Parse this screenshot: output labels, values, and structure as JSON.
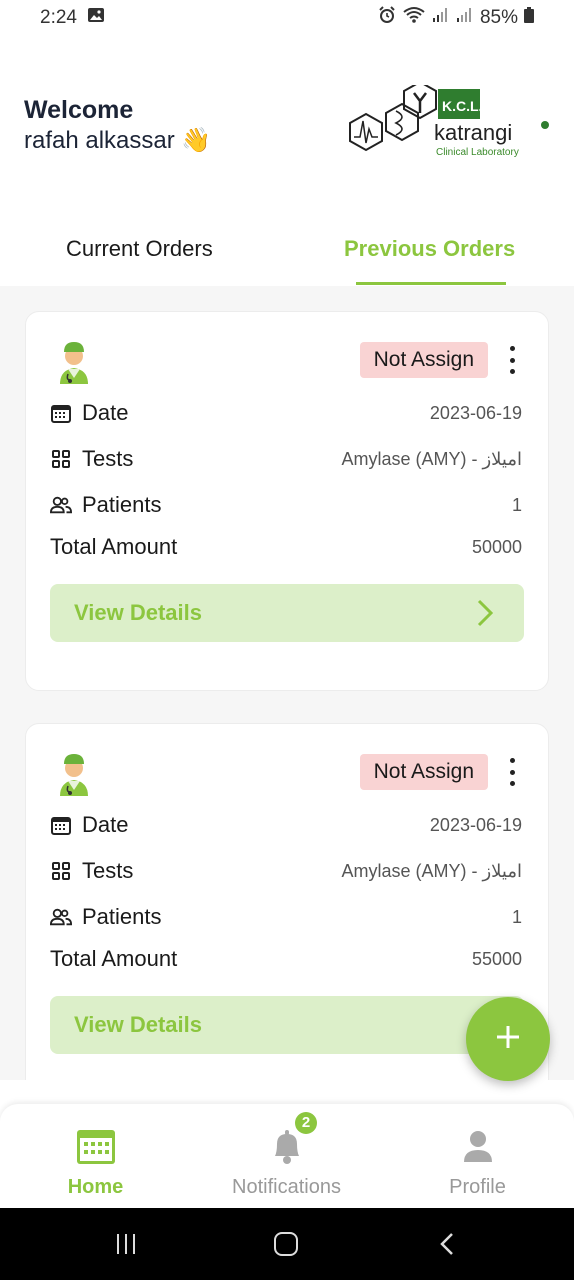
{
  "status_bar": {
    "time": "2:24",
    "battery": "85%"
  },
  "header": {
    "welcome": "Welcome",
    "username": "rafah alkassar 👋",
    "logo_title": "K.C.L.",
    "logo_name": "katrangi",
    "logo_subtitle": "Clinical Laboratory"
  },
  "tabs": {
    "current": "Current Orders",
    "previous": "Previous Orders"
  },
  "orders": [
    {
      "status": "Not Assign",
      "date_label": "Date",
      "date": "2023-06-19",
      "tests_label": "Tests",
      "tests": "Amylase (AMY) - اميلاز",
      "patients_label": "Patients",
      "patients": "1",
      "total_label": "Total Amount",
      "total": "50000",
      "view_details": "View Details"
    },
    {
      "status": "Not Assign",
      "date_label": "Date",
      "date": "2023-06-19",
      "tests_label": "Tests",
      "tests": "Amylase (AMY) - اميلاز",
      "patients_label": "Patients",
      "patients": "1",
      "total_label": "Total Amount",
      "total": "55000",
      "view_details": "View Details"
    }
  ],
  "bottom_nav": {
    "home": "Home",
    "notifications": "Notifications",
    "notifications_count": "2",
    "profile": "Profile"
  },
  "colors": {
    "accent": "#8cc63f",
    "badge_bg": "#f9d3d3",
    "details_bg": "#dcefc9"
  },
  "icons": [
    "calendar-icon",
    "grid-icon",
    "people-icon",
    "doctor-avatar",
    "kebab-menu-icon",
    "chevron-right-icon",
    "plus-icon",
    "bell-icon",
    "person-icon"
  ]
}
